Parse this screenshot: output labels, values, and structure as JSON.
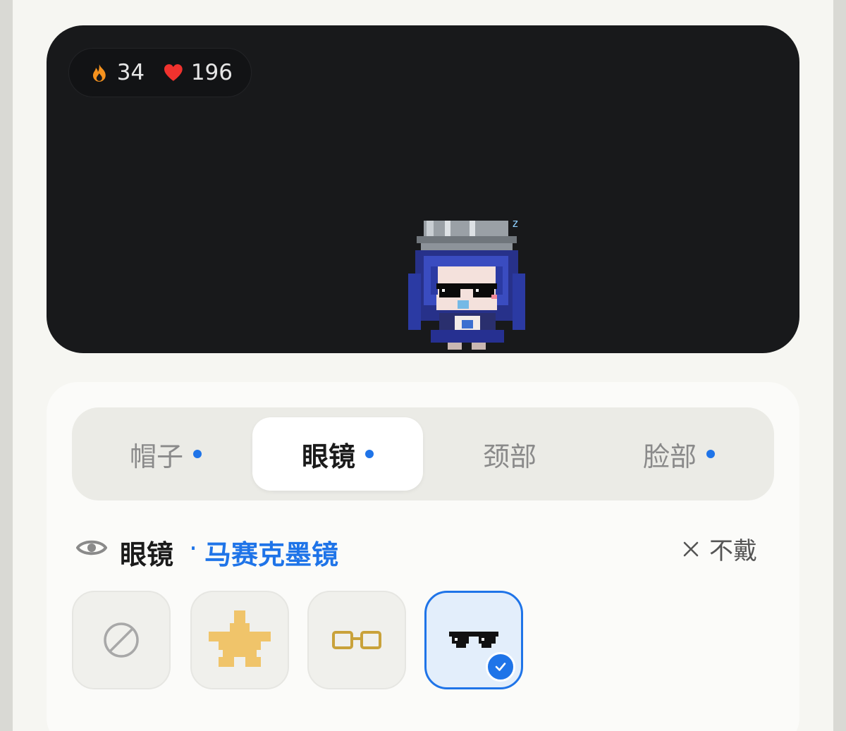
{
  "stats": {
    "streak": "34",
    "likes": "196"
  },
  "tabs": [
    {
      "label": "帽子",
      "dot": true
    },
    {
      "label": "眼镜",
      "dot": true
    },
    {
      "label": "颈部",
      "dot": false
    },
    {
      "label": "脸部",
      "dot": true
    }
  ],
  "active_tab": "眼镜",
  "section": {
    "title": "眼镜",
    "separator": "·",
    "selected_item": "马赛克墨镜",
    "unwear_label": "不戴"
  },
  "items": [
    {
      "icon": "none-icon"
    },
    {
      "icon": "star-icon"
    },
    {
      "icon": "round-glasses-icon"
    },
    {
      "icon": "pixel-sunglasses-icon",
      "selected": true
    }
  ],
  "colors": {
    "accent": "#1f74e8",
    "stage": "#18191b",
    "flame": "#f5921e",
    "heart": "#f0322e"
  }
}
